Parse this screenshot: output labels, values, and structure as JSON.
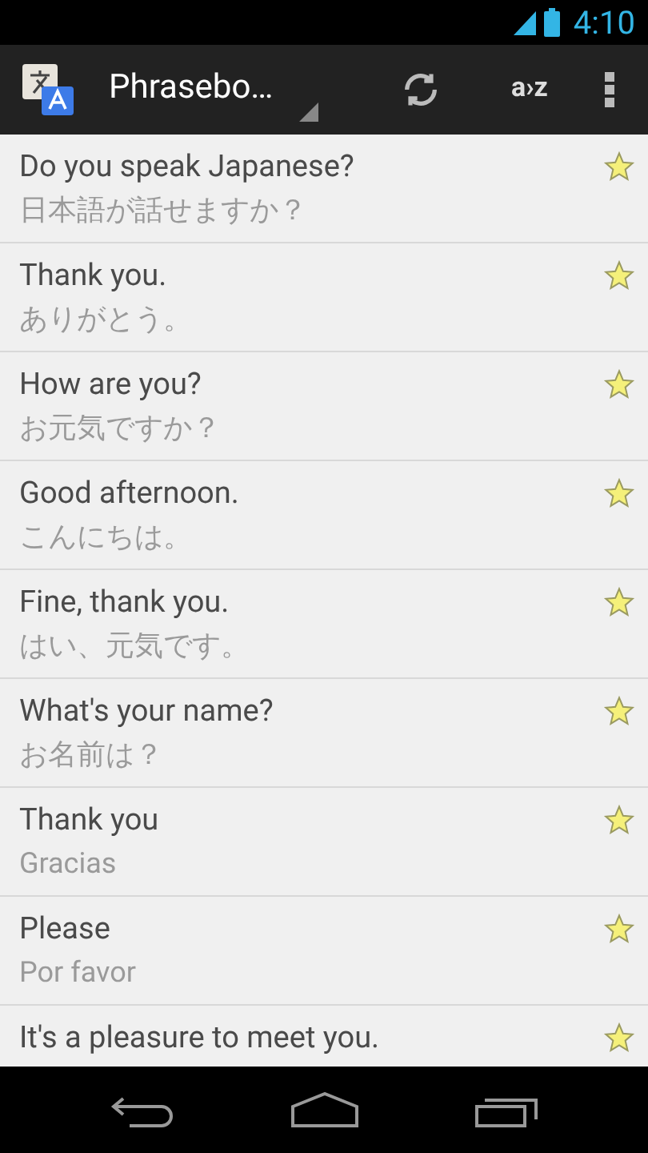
{
  "status_bar": {
    "time": "4:10"
  },
  "action_bar": {
    "title": "Phrasebo…",
    "sort_label": "a›z"
  },
  "phrases": [
    {
      "text": "Do you speak Japanese?",
      "translation": "日本語が話せますか？",
      "starred": true
    },
    {
      "text": "Thank you.",
      "translation": "ありがとう。",
      "starred": true
    },
    {
      "text": "How are you?",
      "translation": "お元気ですか？",
      "starred": true
    },
    {
      "text": "Good afternoon.",
      "translation": "こんにちは。",
      "starred": true
    },
    {
      "text": "Fine, thank you.",
      "translation": "はい、元気です。",
      "starred": true
    },
    {
      "text": "What's your name?",
      "translation": "お名前は？",
      "starred": true
    },
    {
      "text": "Thank you",
      "translation": "Gracias",
      "starred": true
    },
    {
      "text": "Please",
      "translation": "Por favor",
      "starred": true
    },
    {
      "text": "It's a pleasure to meet you.",
      "starred": true
    }
  ]
}
